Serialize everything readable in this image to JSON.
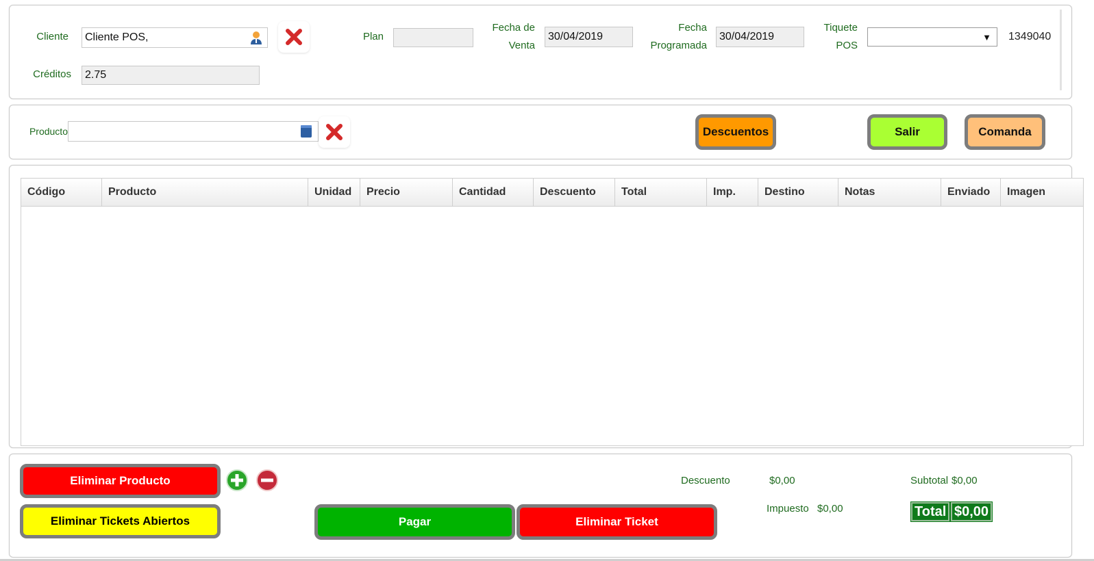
{
  "header": {
    "cliente_label": "Cliente",
    "cliente_value": "Cliente POS,",
    "creditos_label": "Créditos",
    "creditos_value": "2.75",
    "plan_label": "Plan",
    "plan_value": "",
    "fecha_venta_label_1": "Fecha de",
    "fecha_venta_label_2": "Venta",
    "fecha_venta_value": "30/04/2019",
    "fecha_prog_label_1": "Fecha",
    "fecha_prog_label_2": "Programada",
    "fecha_prog_value": "30/04/2019",
    "tiquete_label_1": "Tiquete",
    "tiquete_label_2": "POS",
    "tiquete_value": "",
    "ticket_number": "1349040"
  },
  "product_bar": {
    "producto_label": "Producto",
    "producto_value": "",
    "descuentos_label": "Descuentos",
    "salir_label": "Salir",
    "comanda_label": "Comanda"
  },
  "table": {
    "columns": [
      "Código",
      "Producto",
      "Unidad",
      "Precio",
      "Cantidad",
      "Descuento",
      "Total",
      "Imp.",
      "Destino",
      "Notas",
      "Enviado",
      "Imagen"
    ],
    "rows": []
  },
  "footer": {
    "eliminar_producto_label": "Eliminar Producto",
    "eliminar_tickets_label": "Eliminar Tickets Abiertos",
    "pagar_label": "Pagar",
    "eliminar_ticket_label": "Eliminar Ticket",
    "descuento_label": "Descuento",
    "descuento_value": "$0,00",
    "impuesto_label": "Impuesto",
    "impuesto_value": "$0,00",
    "subtotal_label": "Subtotal",
    "subtotal_value": "$0,00",
    "total_label": "Total",
    "total_value": "$0,00"
  },
  "colors": {
    "label_green": "#1f6b1f",
    "descuentos_btn": "#ff9900",
    "salir_btn": "#aaff33",
    "comanda_btn": "#ffc07a",
    "red_btn": "#ff0000",
    "yellow_btn": "#ffff00",
    "pagar_btn": "#00b300",
    "total_bg": "#0f7a1b"
  },
  "icons": {
    "cliente_lookup": "user-icon",
    "cliente_clear": "close-icon",
    "producto_lookup": "book-icon",
    "producto_clear": "close-icon",
    "qty_add": "plus-icon",
    "qty_remove": "minus-icon",
    "tiquete_dropdown": "caret-down-icon"
  }
}
